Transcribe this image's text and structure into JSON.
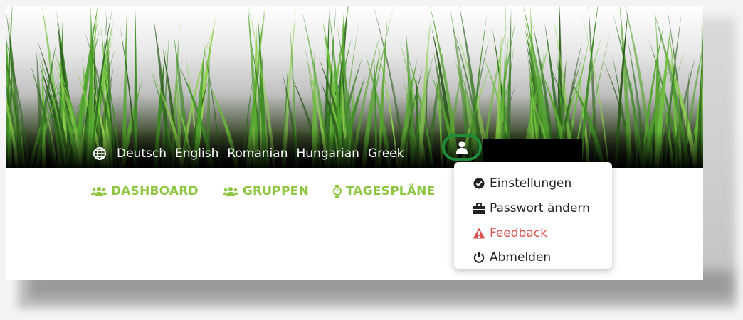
{
  "languages": {
    "items": [
      "Deutsch",
      "English",
      "Romanian",
      "Hungarian",
      "Greek"
    ],
    "icon": "globe-icon"
  },
  "user_menu": {
    "icon": "user-icon",
    "highlight_color": "#1f8c3a",
    "items": [
      {
        "label": "Einstellungen",
        "icon": "check-circle-icon"
      },
      {
        "label": "Passwort ändern",
        "icon": "briefcase-icon"
      },
      {
        "label": "Feedback",
        "icon": "warning-icon",
        "color": "#d9534f"
      },
      {
        "label": "Abmelden",
        "icon": "power-icon"
      }
    ]
  },
  "nav": {
    "accent": "#8dc63f",
    "items": [
      {
        "label": "DASHBOARD",
        "icon": "users-icon"
      },
      {
        "label": "GRUPPEN",
        "icon": "users-icon"
      },
      {
        "label": "TAGESPLÄNE",
        "icon": "stopwatch-icon"
      }
    ],
    "partial_icon": "chart-icon"
  }
}
